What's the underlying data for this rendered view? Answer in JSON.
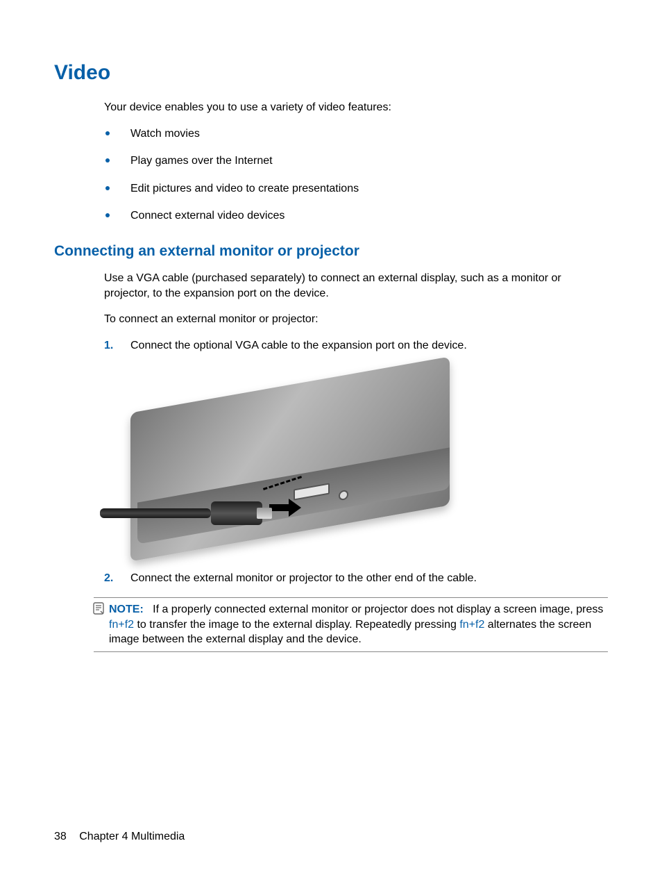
{
  "heading1": "Video",
  "intro": "Your device enables you to use a variety of video features:",
  "features": [
    "Watch movies",
    "Play games over the Internet",
    "Edit pictures and video to create presentations",
    "Connect external video devices"
  ],
  "heading2": "Connecting an external monitor or projector",
  "para1": "Use a VGA cable (purchased separately) to connect an external display, such as a monitor or projector, to the expansion port on the device.",
  "para2": "To connect an external monitor or projector:",
  "step1_num": "1.",
  "step1": "Connect the optional VGA cable to the expansion port on the device.",
  "step2_num": "2.",
  "step2": "Connect the external monitor or projector to the other end of the cable.",
  "note_label": "NOTE:",
  "note_seg1": "If a properly connected external monitor or projector does not display a screen image, press ",
  "note_kbd1": "fn+f2",
  "note_seg2": " to transfer the image to the external display. Repeatedly pressing ",
  "note_kbd2": "fn+f2",
  "note_seg3": " alternates the screen image between the external display and the device.",
  "footer_page": "38",
  "footer_chapter": "Chapter 4   Multimedia"
}
